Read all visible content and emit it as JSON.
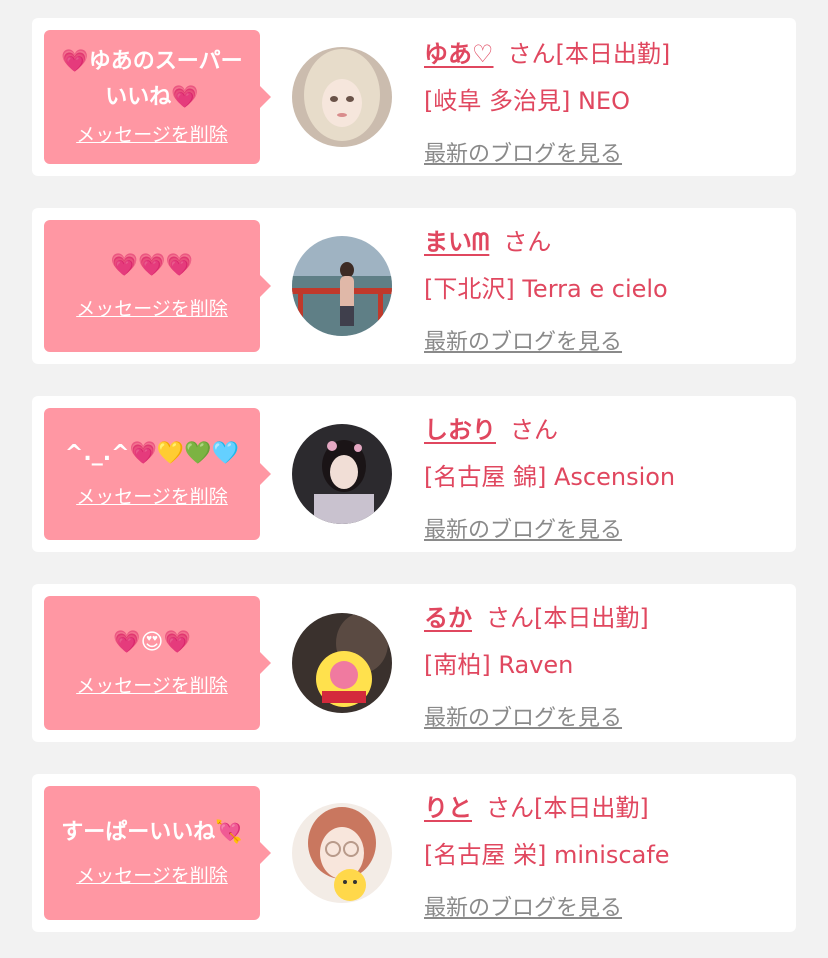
{
  "delete_label": "メッセージを削除",
  "blog_label": "最新のブログを見る",
  "honorific": "さん",
  "colors": {
    "accent": "#e0475f",
    "bubble": "#ff97a3",
    "link_gray": "#8a8a8a",
    "background": "#f2f2f2"
  },
  "messages": [
    {
      "text": "💗ゆあのスーパー\nいいね💗",
      "name": "ゆあ♡",
      "today": "[本日出勤]",
      "shop": "[岐阜 多治見] NEO",
      "avatar_icon": "profile-photo-icon"
    },
    {
      "text": "💗💗💗",
      "name": "まいᗰ",
      "today": "",
      "shop": "[下北沢] Terra e cielo",
      "avatar_icon": "profile-photo-icon"
    },
    {
      "text": "^._.^💗💛💚🩵",
      "name": "しおり",
      "today": "",
      "shop": "[名古屋 錦] Ascension",
      "avatar_icon": "profile-photo-icon"
    },
    {
      "text": "💗😍💗",
      "name": "るか",
      "today": "[本日出勤]",
      "shop": "[南柏] Raven",
      "avatar_icon": "profile-photo-icon"
    },
    {
      "text": "すーぱーいいね💘",
      "name": "りと",
      "today": "[本日出勤]",
      "shop": "[名古屋 栄] miniscafe",
      "avatar_icon": "profile-photo-icon"
    }
  ]
}
